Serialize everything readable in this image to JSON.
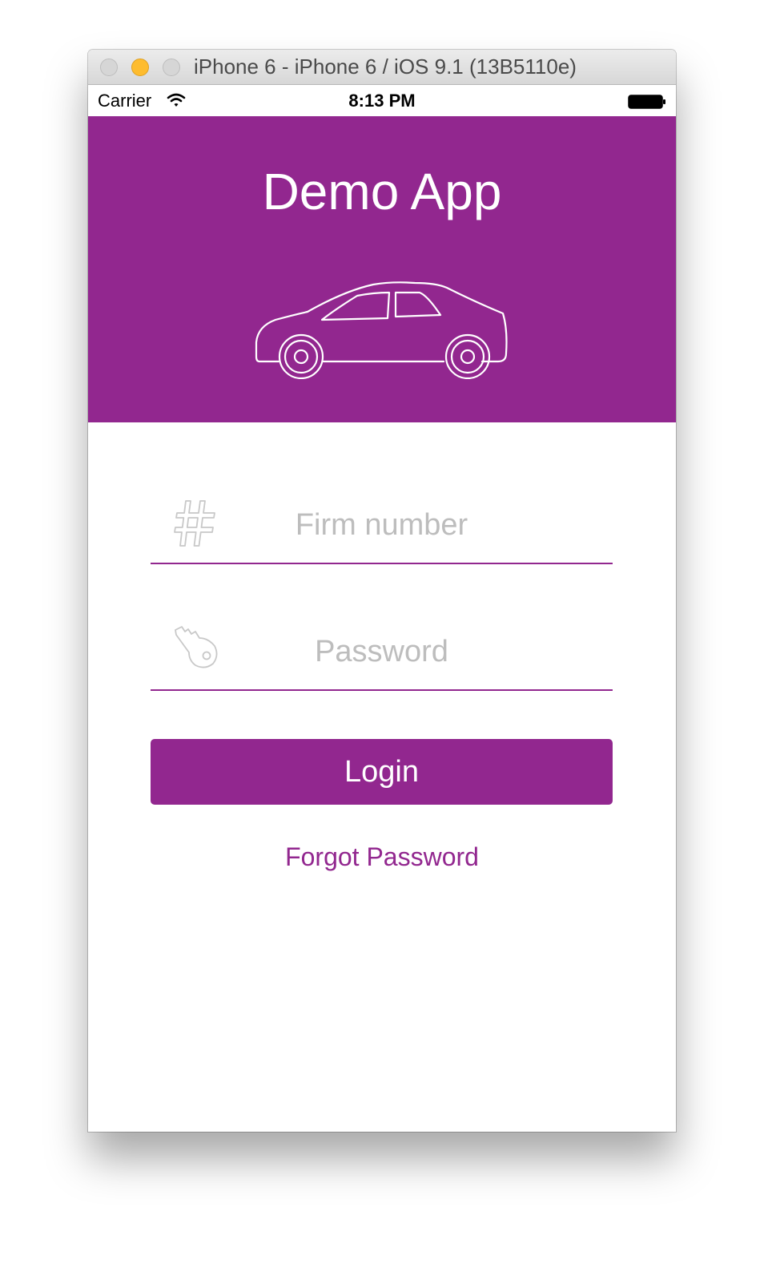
{
  "window": {
    "title": "iPhone 6 - iPhone 6 / iOS 9.1 (13B5110e)"
  },
  "status_bar": {
    "carrier": "Carrier",
    "time": "8:13 PM"
  },
  "header": {
    "app_title": "Demo App",
    "icon": "car-icon"
  },
  "form": {
    "firm_number": {
      "placeholder": "Firm number",
      "value": "",
      "icon": "hash-icon"
    },
    "password": {
      "placeholder": "Password",
      "value": "",
      "icon": "key-icon"
    },
    "login_label": "Login",
    "forgot_label": "Forgot Password"
  },
  "colors": {
    "accent": "#92278f",
    "placeholder": "#bdbdbd",
    "icon_stroke": "#c8c8c8"
  }
}
